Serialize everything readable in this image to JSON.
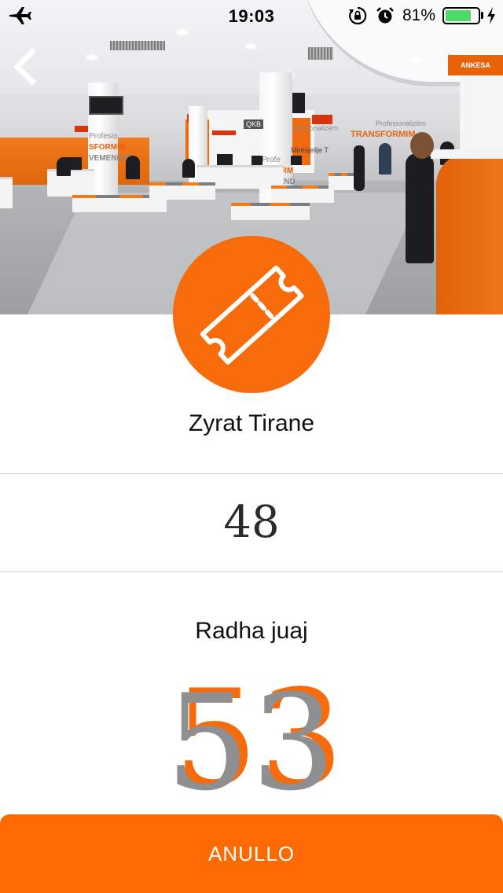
{
  "status_bar": {
    "time": "19:03",
    "battery_percent": "81%",
    "battery_level": 0.81,
    "icons": [
      "airplane-mode-icon",
      "rotation-lock-icon",
      "alarm-icon",
      "battery-icon",
      "charging-bolt-icon"
    ]
  },
  "hero": {
    "wall_sign_line1": "Profesionalizëm",
    "wall_sign_line2": "TRANSFORMIM",
    "pillar_text_1": "Profesio",
    "pillar_text_2": "SFORMIM",
    "pillar_text_3": "VEMENDJE",
    "mid_sign_1": "rofesionalizëm",
    "mid_sign_2": "Mirësjellje T",
    "pillar2_text_1": "Profe",
    "pillar2_text_2": "NSFORM",
    "pillar2_text_3": "VEMEND",
    "qkb_sign": "QKB",
    "ankesa_sign": "ANKESA"
  },
  "ticket": {
    "icon": "ticket-icon",
    "office_name": "Zyrat Tirane",
    "current_number": "48",
    "queue_label": "Radha juaj",
    "my_number": "53"
  },
  "actions": {
    "cancel_label": "ANULLO"
  },
  "colors": {
    "accent": "#fd6a02",
    "number_gray": "#8f8f92",
    "battery_green": "#4cd964"
  }
}
